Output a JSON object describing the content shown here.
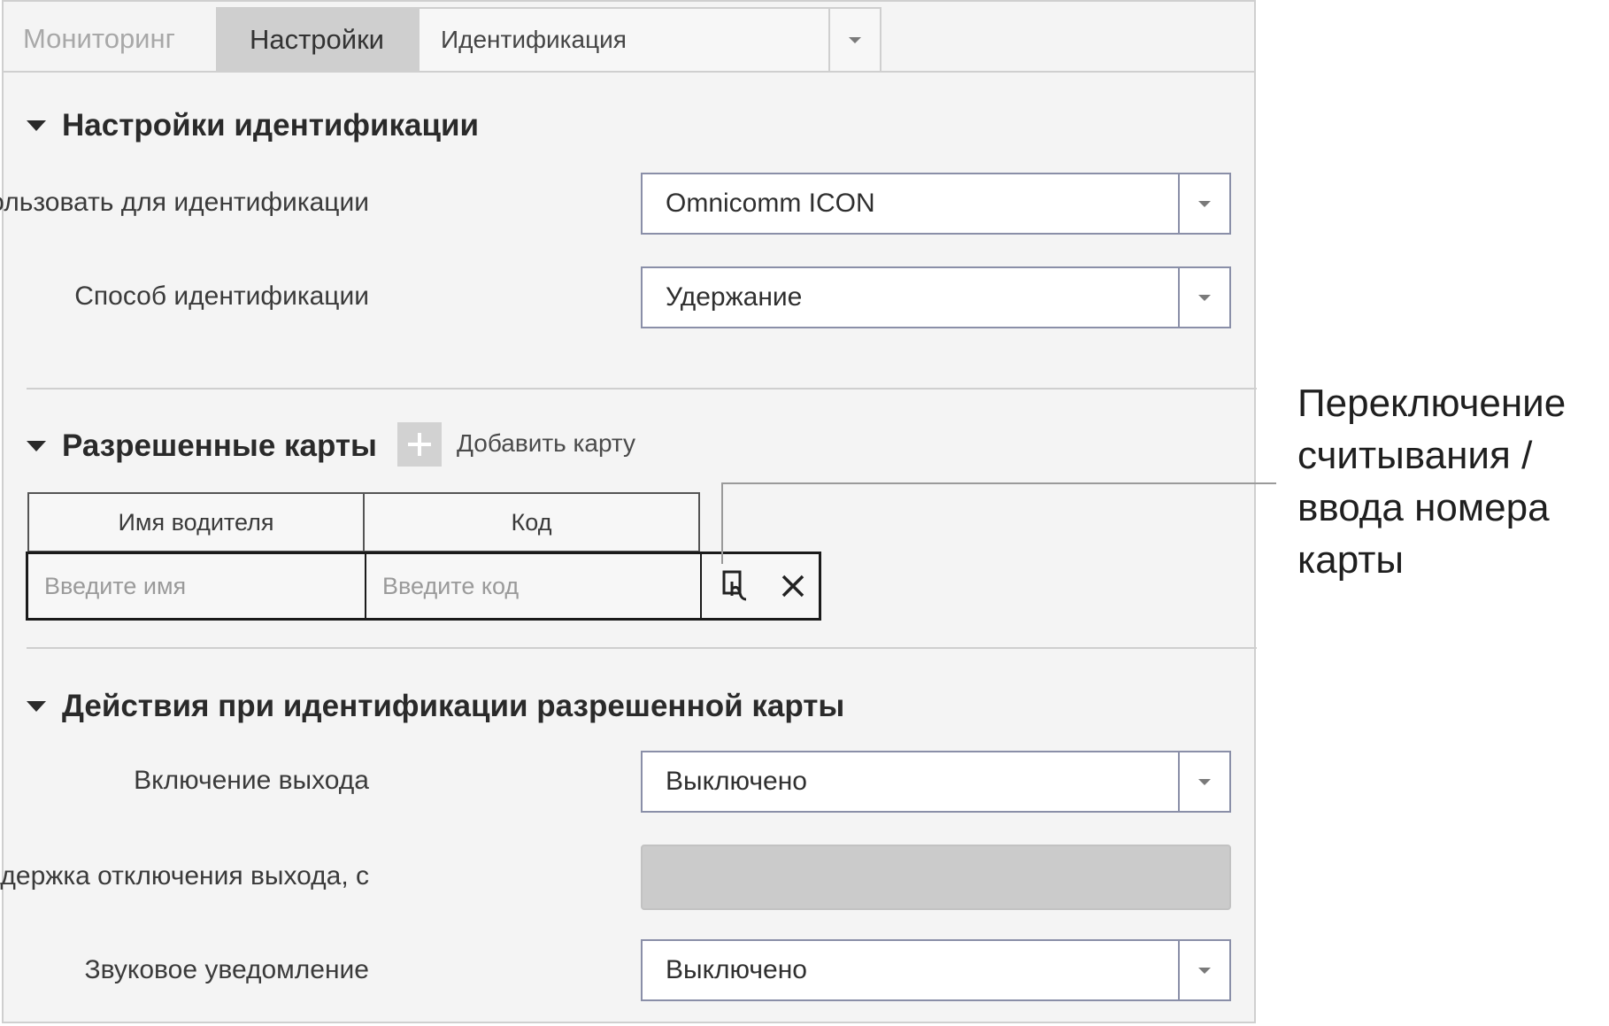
{
  "tabs": {
    "monitoring": "Мониторинг",
    "settings": "Настройки",
    "selected_device": "Идентификация"
  },
  "identification_settings": {
    "title": "Настройки идентификации",
    "use_for_label": "Использовать для идентификации",
    "use_for_value": "Omnicomm ICON",
    "method_label": "Способ идентификации",
    "method_value": "Удержание"
  },
  "allowed_cards": {
    "title": "Разрешенные карты",
    "add_label": "Добавить карту",
    "columns": [
      "Имя водителя",
      "Код"
    ],
    "name_placeholder": "Введите имя",
    "code_placeholder": "Введите код"
  },
  "actions": {
    "title": "Действия при идентификации разрешенной карты",
    "output_label": "Включение выхода",
    "output_value": "Выключено",
    "delay_label": "Задержка отключения выхода, с",
    "sound_label": "Звуковое уведомление",
    "sound_value": "Выключено"
  },
  "annotation": {
    "lines": [
      "Переключение",
      "считывания /",
      "ввода номера",
      "карты"
    ]
  },
  "icons": {
    "add": "plus-icon",
    "toggle": "card-touch-icon",
    "remove": "close-icon",
    "dropdown": "chevron-down-icon",
    "collapse": "triangle-down-icon"
  }
}
